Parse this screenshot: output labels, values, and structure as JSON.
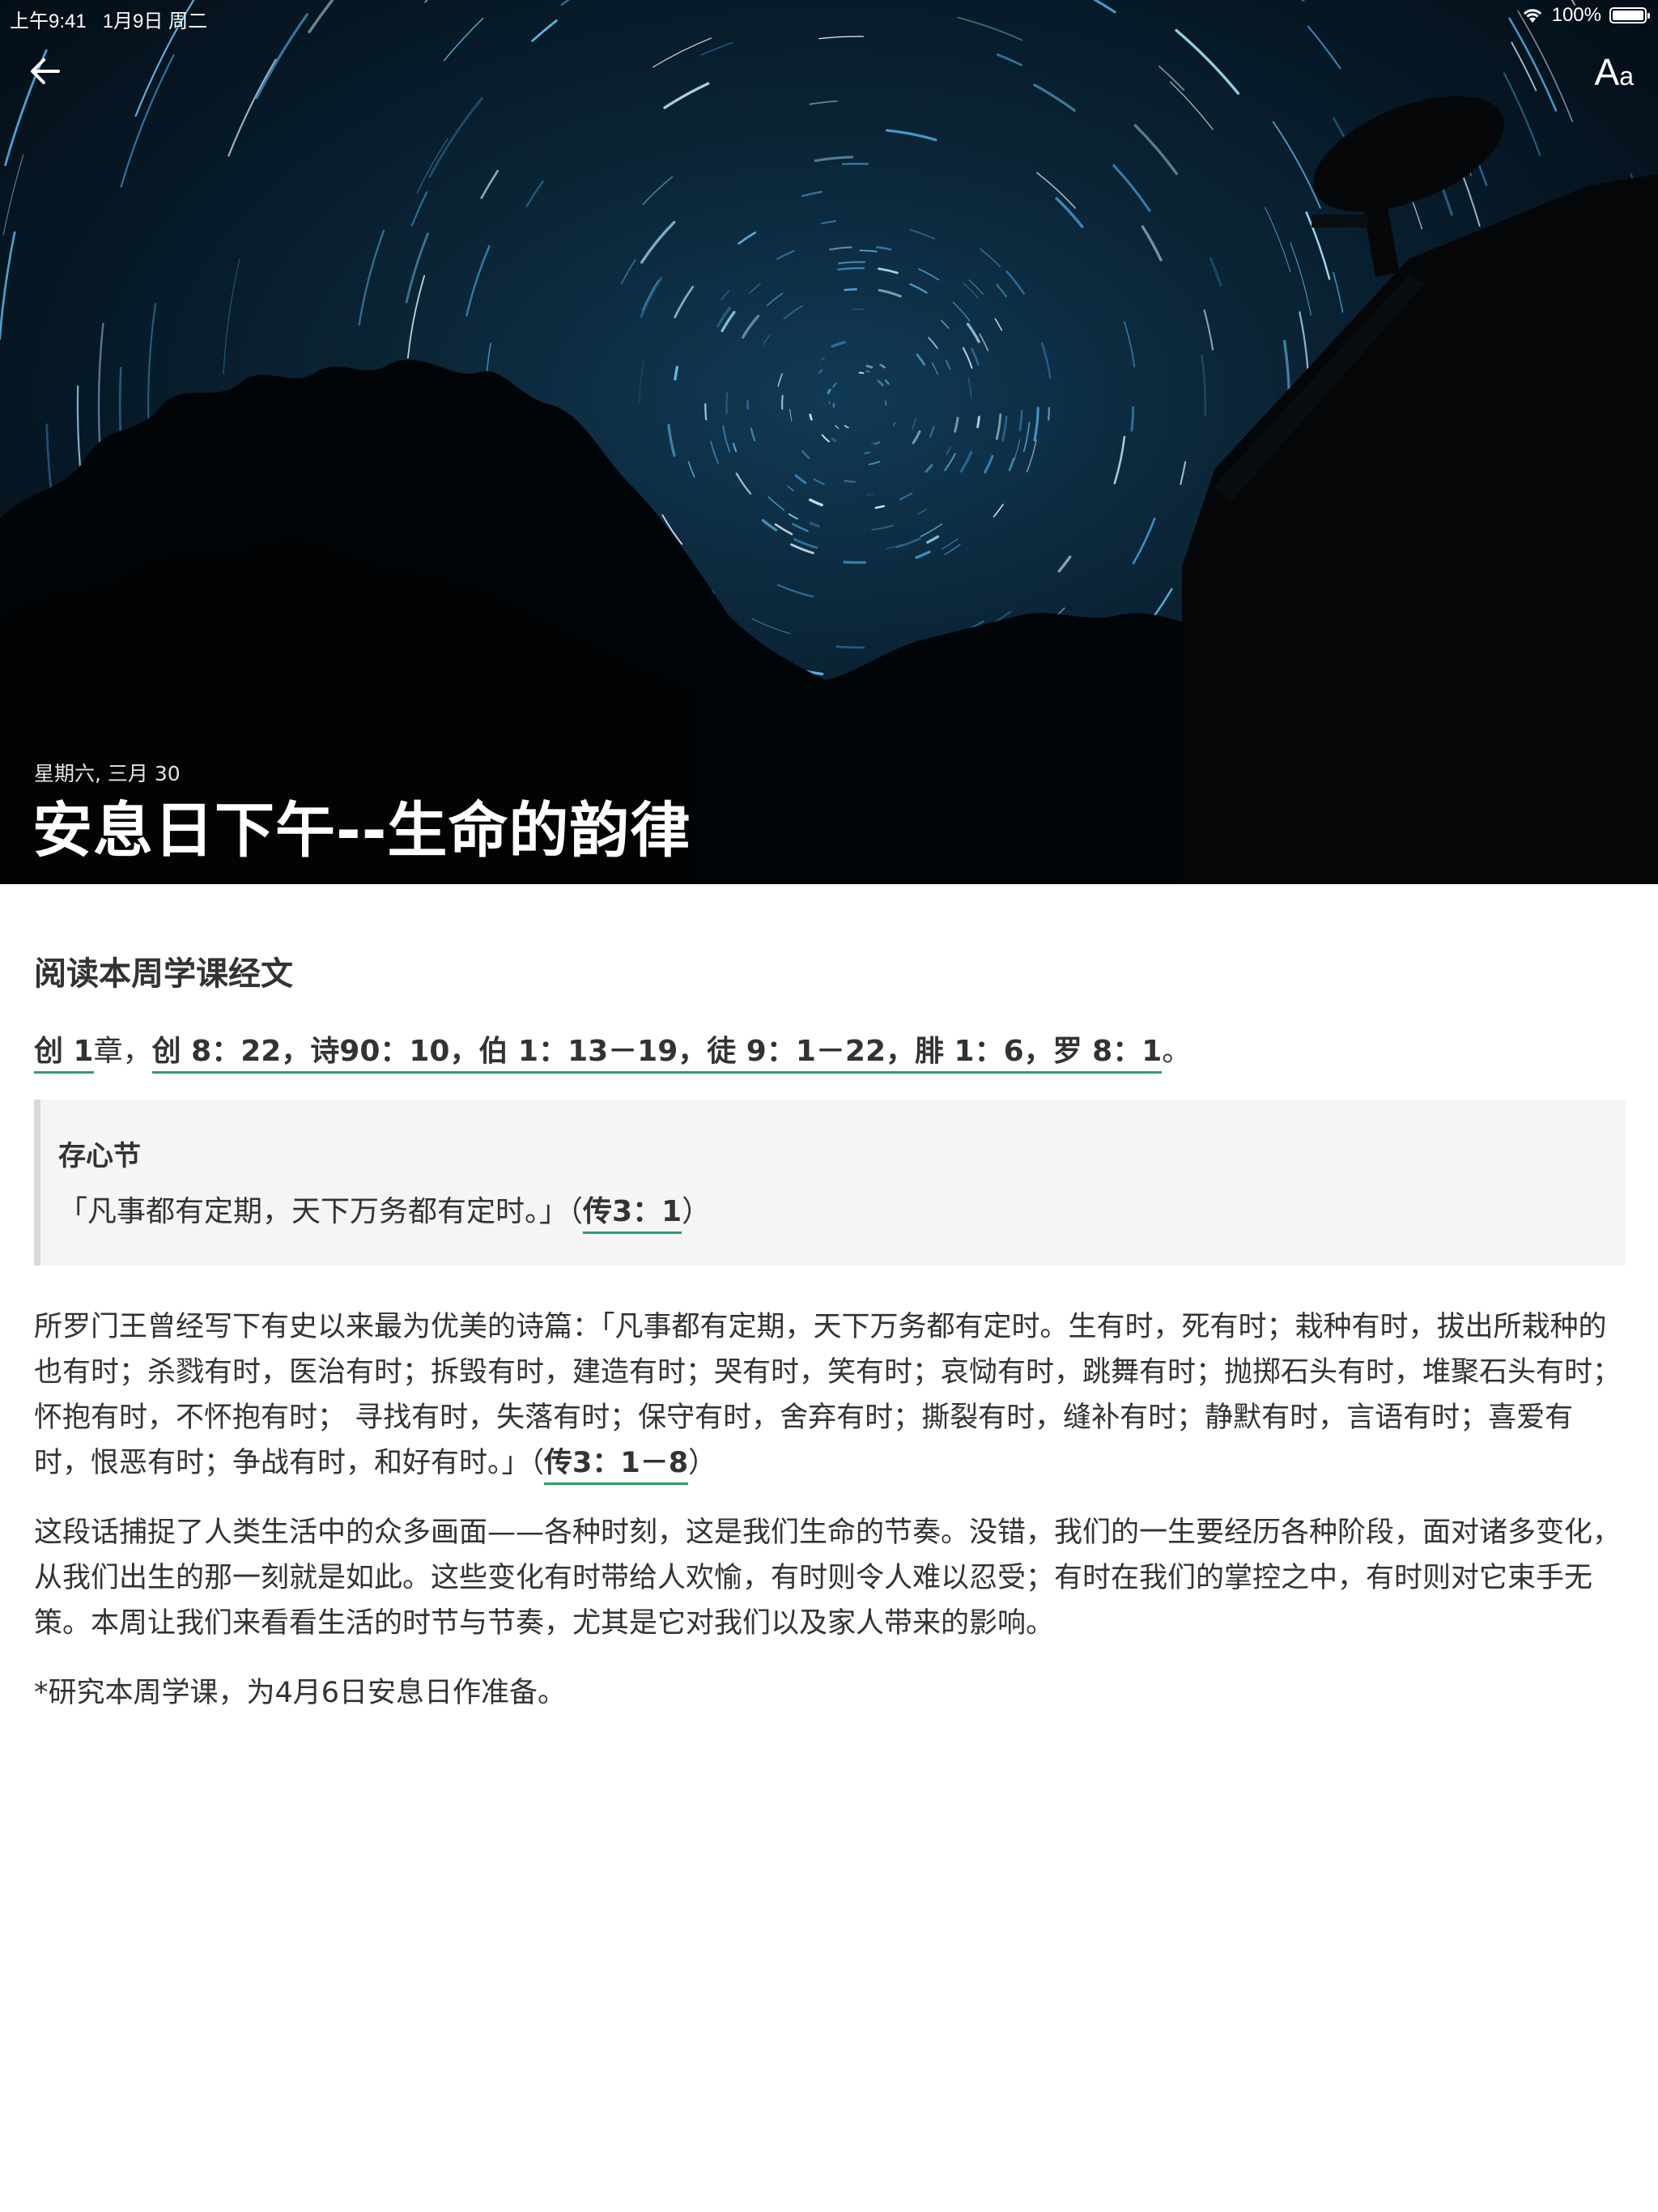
{
  "status_bar": {
    "time_date": "上午9:41   1月9日 周二",
    "wifi_icon": "wifi-icon",
    "battery_text": "100%",
    "battery_level": 1.0
  },
  "toolbar": {
    "back_icon": "arrow-left-icon",
    "font_big": "A",
    "font_small": "a"
  },
  "hero": {
    "date": "星期六, 三月 30",
    "title": "安息日下午--生命的韵律"
  },
  "reading": {
    "heading": "阅读本周学课经文",
    "refs": [
      {
        "text": "创 1",
        "link": true
      },
      {
        "text": "章，",
        "link": false
      },
      {
        "text": "创 8：22，诗90：10，伯 1：13－19，徒 9：1－22，腓 1：6，罗 8：1",
        "link": true
      },
      {
        "text": "。",
        "link": false
      }
    ]
  },
  "memory": {
    "title": "存心节",
    "quote": "「凡事都有定期，天下万务都有定时。」（",
    "ref": "传3：1",
    "close": "）"
  },
  "paragraphs": {
    "p1_text": "所罗门王曾经写下有史以来最为优美的诗篇：「凡事都有定期，天下万务都有定时。生有时，死有时；栽种有时，拔出所栽种的也有时；杀戮有时，医治有时；拆毁有时，建造有时；哭有时，笑有时；哀恸有时，跳舞有时；抛掷石头有时，堆聚石头有时；怀抱有时，不怀抱有时； 寻找有时，失落有时；保守有时，舍弃有时；撕裂有时，缝补有时；静默有时，言语有时；喜爱有时，恨恶有时；争战有时，和好有时。」（",
    "p1_ref": "传3：1－8",
    "p1_close": "）",
    "p2": "这段话捕捉了人类生活中的众多画面——各种时刻，这是我们生命的节奏。没错，我们的一生要经历各种阶段，面对诸多变化，从我们出生的那一刻就是如此。这些变化有时带给人欢愉，有时则令人难以忍受；有时在我们的掌控之中，有时则对它束手无策。本周让我们来看看生活的时节与节奏，尤其是它对我们以及家人带来的影响。",
    "p3": "*研究本周学课，为4月6日安息日作准备。"
  }
}
